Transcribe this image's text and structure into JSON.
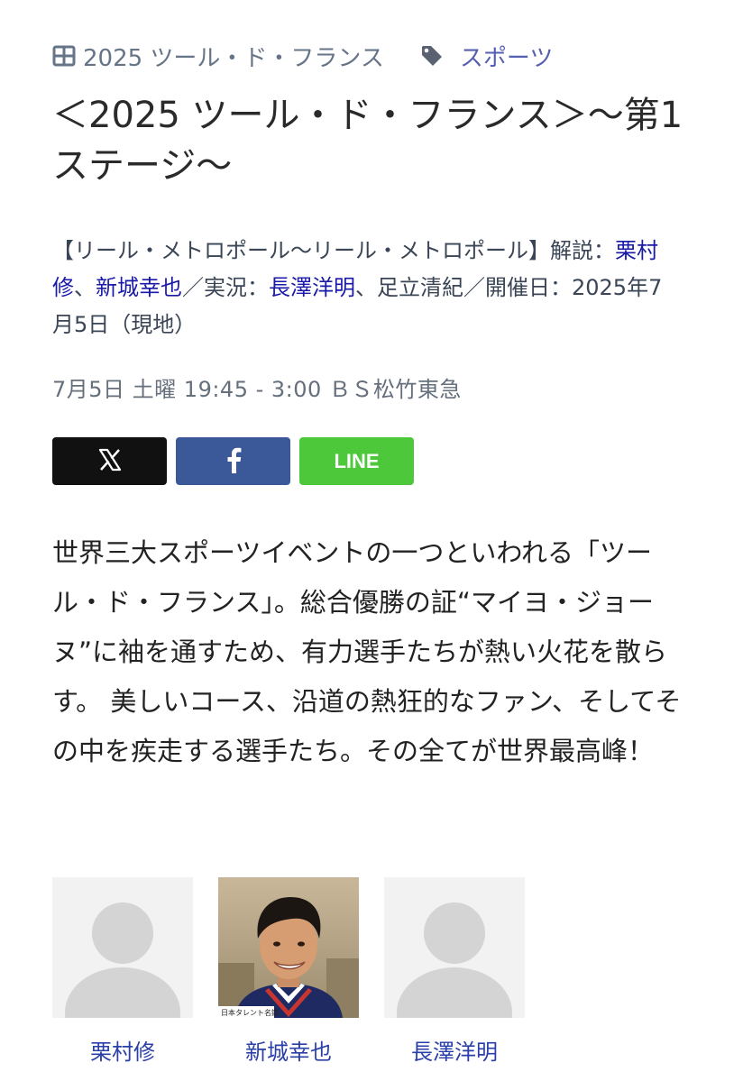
{
  "meta": {
    "category": "2025 ツール・ド・フランス",
    "tag": "スポーツ"
  },
  "title": "＜2025 ツール・ド・フランス＞～第1ステージ～",
  "description": {
    "prefix": "【リール・メトロポール～リール・メトロポール】解説：",
    "commentator1": "栗村修",
    "sep1": "、",
    "commentator2": "新城幸也",
    "middle": "／実況：",
    "announcer1": "長澤洋明",
    "suffix": "、足立清紀／開催日：2025年7月5日（現地）"
  },
  "broadcast": "7月5日 土曜 19:45 - 3:00 ＢＳ松竹東急",
  "share": {
    "line_label": "LINE"
  },
  "body_text": "世界三大スポーツイベントの一つといわれる「ツール・ド・フランス」。総合優勝の証“マイヨ・ジョーヌ”に袖を通すため、有力選手たちが熱い火花を散らす。 美しいコース、沿道の熱狂的なファン、そしてその中を疾走する選手たち。その全てが世界最高峰！",
  "cast": [
    {
      "name": "栗村修",
      "photo": "placeholder-avatar"
    },
    {
      "name": "新城幸也",
      "photo": "portrait",
      "caption": "日本タレント名鑑"
    },
    {
      "name": "長澤洋明",
      "photo": "placeholder-avatar"
    }
  ],
  "colors": {
    "link": "#1a1aa8",
    "x": "#111111",
    "facebook": "#3b5998",
    "line": "#4cc83a"
  }
}
